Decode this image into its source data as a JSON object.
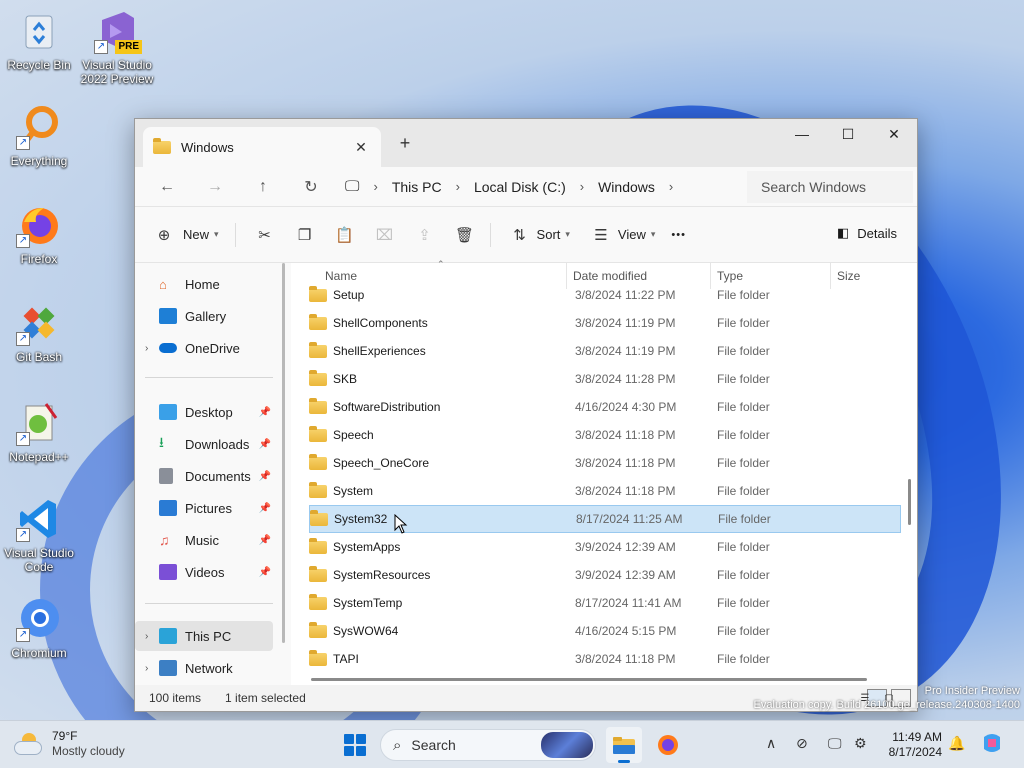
{
  "desktop": {
    "icons": [
      {
        "label": "Recycle Bin",
        "icon": "recycle-bin-icon"
      },
      {
        "label": "Visual Studio 2022 Preview",
        "icon": "visual-studio-preview-icon",
        "badge": "PRE"
      },
      {
        "label": "Everything",
        "icon": "everything-search-icon"
      },
      {
        "label": "Firefox",
        "icon": "firefox-icon"
      },
      {
        "label": "Git Bash",
        "icon": "git-bash-icon"
      },
      {
        "label": "Notepad++",
        "icon": "notepad-plus-plus-icon"
      },
      {
        "label": "Visual Studio Code",
        "icon": "vscode-icon"
      },
      {
        "label": "Chromium",
        "icon": "chromium-icon"
      }
    ]
  },
  "window": {
    "tab_title": "Windows",
    "tab_close": "✕",
    "new_tab": "+",
    "controls": {
      "minimize": "—",
      "maximize": "☐",
      "close": "✕"
    },
    "breadcrumb": [
      "This PC",
      "Local Disk (C:)",
      "Windows"
    ],
    "search_placeholder": "Search Windows",
    "toolbar": {
      "new_label": "New",
      "sort_label": "Sort",
      "view_label": "View",
      "more_label": "•••",
      "details_label": "Details"
    },
    "nav": {
      "items": [
        {
          "label": "Home",
          "icon": "home-icon",
          "color": "#e0672b"
        },
        {
          "label": "Gallery",
          "icon": "gallery-icon",
          "color": "#1e7fd6"
        },
        {
          "label": "OneDrive",
          "icon": "onedrive-icon",
          "color": "#0a6ed1"
        },
        {
          "label": "Desktop",
          "icon": "desktop-icon",
          "color": "#3aa0e8"
        },
        {
          "label": "Downloads",
          "icon": "downloads-icon",
          "color": "#18a058"
        },
        {
          "label": "Documents",
          "icon": "documents-icon",
          "color": "#8a8f99"
        },
        {
          "label": "Pictures",
          "icon": "pictures-icon",
          "color": "#2a7bd4"
        },
        {
          "label": "Music",
          "icon": "music-icon",
          "color": "#e2574c"
        },
        {
          "label": "Videos",
          "icon": "videos-icon",
          "color": "#7b4fd6"
        },
        {
          "label": "This PC",
          "icon": "this-pc-icon",
          "color": "#2aa3d8"
        },
        {
          "label": "Network",
          "icon": "network-icon",
          "color": "#3c7fc4"
        }
      ]
    },
    "columns": {
      "name": "Name",
      "date": "Date modified",
      "type": "Type",
      "size": "Size"
    },
    "files": [
      {
        "name": "Setup",
        "date": "3/8/2024 11:22 PM",
        "type": "File folder"
      },
      {
        "name": "ShellComponents",
        "date": "3/8/2024 11:19 PM",
        "type": "File folder"
      },
      {
        "name": "ShellExperiences",
        "date": "3/8/2024 11:19 PM",
        "type": "File folder"
      },
      {
        "name": "SKB",
        "date": "3/8/2024 11:28 PM",
        "type": "File folder"
      },
      {
        "name": "SoftwareDistribution",
        "date": "4/16/2024 4:30 PM",
        "type": "File folder"
      },
      {
        "name": "Speech",
        "date": "3/8/2024 11:18 PM",
        "type": "File folder"
      },
      {
        "name": "Speech_OneCore",
        "date": "3/8/2024 11:18 PM",
        "type": "File folder"
      },
      {
        "name": "System",
        "date": "3/8/2024 11:18 PM",
        "type": "File folder"
      },
      {
        "name": "System32",
        "date": "8/17/2024 11:25 AM",
        "type": "File folder",
        "selected": true
      },
      {
        "name": "SystemApps",
        "date": "3/9/2024 12:39 AM",
        "type": "File folder"
      },
      {
        "name": "SystemResources",
        "date": "3/9/2024 12:39 AM",
        "type": "File folder"
      },
      {
        "name": "SystemTemp",
        "date": "8/17/2024 11:41 AM",
        "type": "File folder"
      },
      {
        "name": "SysWOW64",
        "date": "4/16/2024 5:15 PM",
        "type": "File folder"
      },
      {
        "name": "TAPI",
        "date": "3/8/2024 11:18 PM",
        "type": "File folder"
      }
    ],
    "status": {
      "count": "100 items",
      "selection": "1 item selected"
    }
  },
  "watermark": {
    "line1": "Pro Insider Preview",
    "line2": "Evaluation copy. Build 26100.ge_release.240308-1400"
  },
  "taskbar": {
    "weather_temp": "79°F",
    "weather_cond": "Mostly cloudy",
    "search_label": "Search",
    "time": "11:49 AM",
    "date": "8/17/2024",
    "tray_chevron": "∧",
    "accent": "#0a6ed1"
  }
}
